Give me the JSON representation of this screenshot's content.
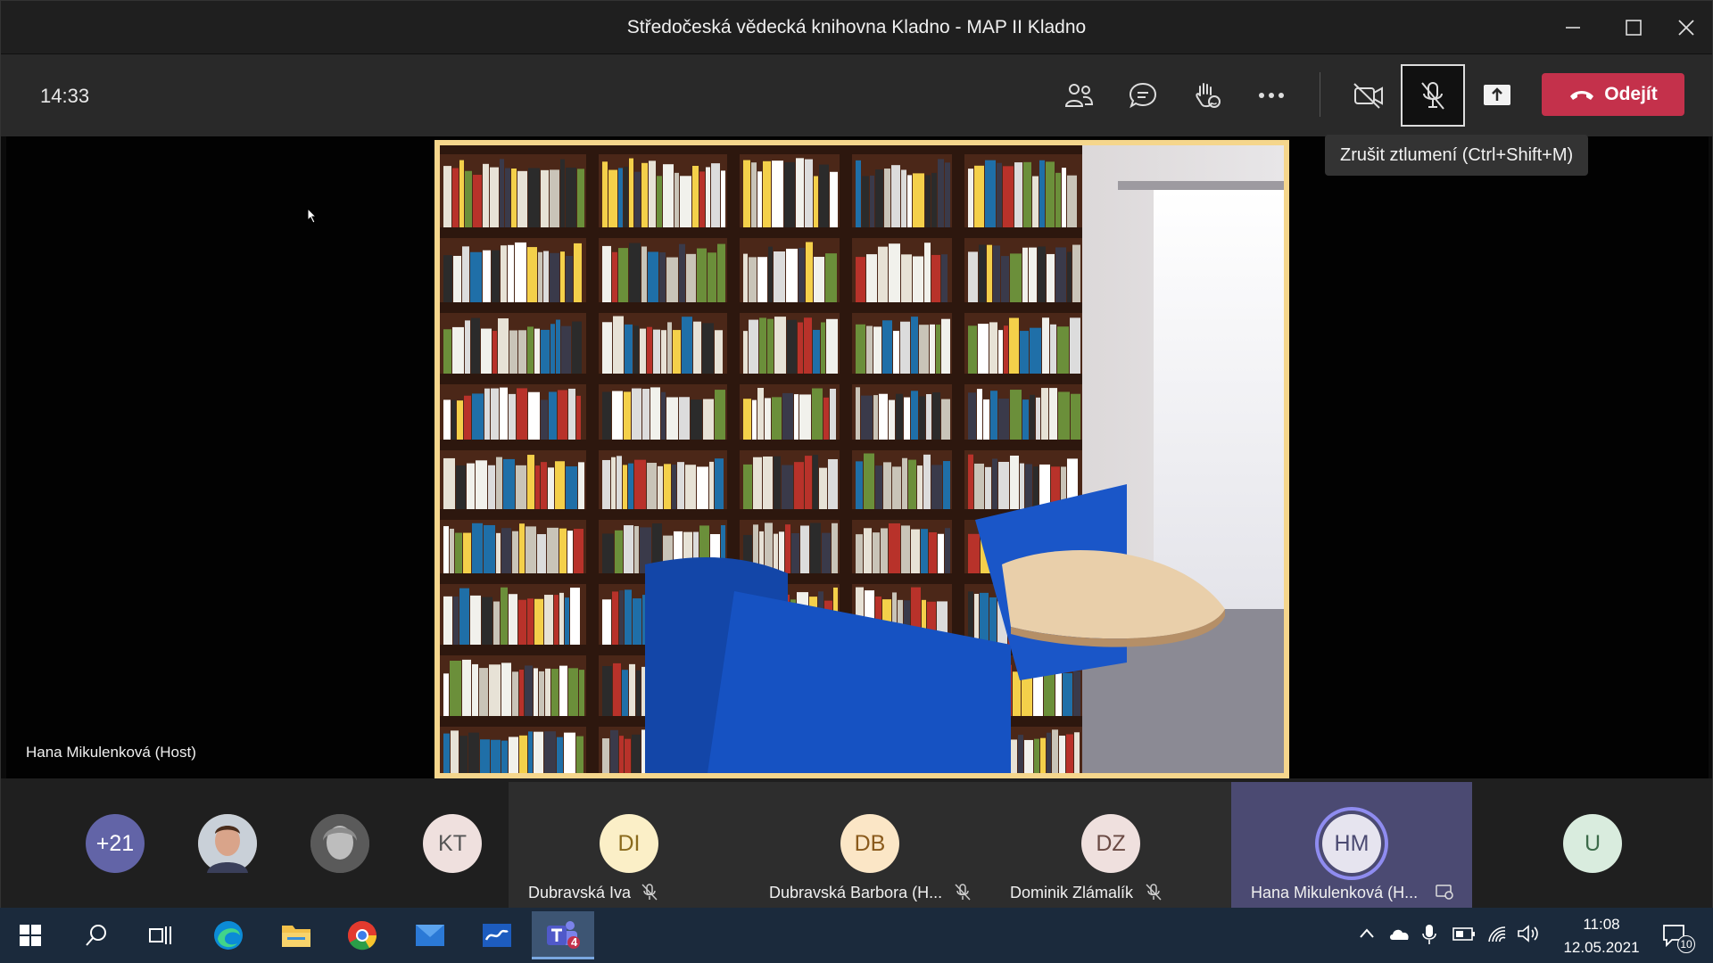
{
  "window": {
    "title": "Středočeská vědecká knihovna Kladno - MAP II Kladno"
  },
  "toolbar": {
    "time": "14:33",
    "leave_label": "Odejít",
    "tooltip": "Zrušit ztlumení (Ctrl+Shift+M)",
    "icons": [
      "people-icon",
      "chat-icon",
      "raise-hand-icon",
      "more-icon",
      "camera-off-icon",
      "mic-muted-icon",
      "share-screen-icon",
      "hang-up-icon"
    ]
  },
  "stage": {
    "presenter_name": "Hana Mikulenková (Host)"
  },
  "participants": {
    "overflow_count": "+21",
    "avatars": [
      {
        "initials": "KT",
        "color": "#efe0de"
      }
    ],
    "tiles": [
      {
        "initials": "DI",
        "name": "Dubravská Iva",
        "color": "#fbefc7"
      },
      {
        "initials": "DB",
        "name": "Dubravská Barbora (H...",
        "color": "#fbe6c6"
      },
      {
        "initials": "DZ",
        "name": "Dominik Zlámalík",
        "color": "#efe0de"
      },
      {
        "initials": "HM",
        "name": "Hana Mikulenková (H...",
        "color": "#e6e4ef"
      }
    ],
    "last": {
      "initials": "U",
      "color": "#d9ecde"
    }
  },
  "taskbar": {
    "clock_time": "11:08",
    "clock_date": "12.05.2021",
    "teams_badge": "4",
    "notification_count": "10"
  },
  "colors": {
    "accent": "#6264a7",
    "leave": "#c4314b",
    "speaker_border": "#f5d68c"
  }
}
